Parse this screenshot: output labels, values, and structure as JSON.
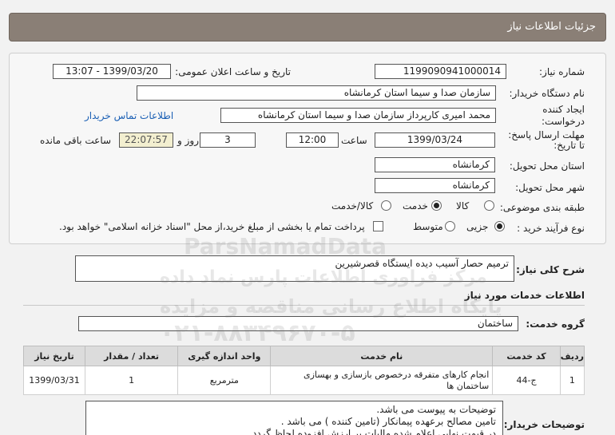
{
  "header": {
    "title": "جزئیات اطلاعات نیاز"
  },
  "fields": {
    "need_number_label": "شماره نیاز:",
    "need_number": "1199090941000014",
    "announce_label": "تاریخ و ساعت اعلان عمومی:",
    "announce_value": "1399/03/20 - 13:07",
    "buyer_label": "نام دستگاه خریدار:",
    "buyer_value": "سازمان صدا و سیما استان کرمانشاه",
    "creator_label_1": "ایجاد کننده",
    "creator_label_2": "درخواست:",
    "creator_value": "محمد امیری کارپرداز سازمان صدا و سیما استان کرمانشاه",
    "contact_link": "اطلاعات تماس خریدار",
    "deadline_label_1": "مهلت ارسال پاسخ:",
    "deadline_label_2": "تا تاریخ:",
    "deadline_date": "1399/03/24",
    "time_label": "ساعت",
    "deadline_time": "12:00",
    "days_value": "3",
    "days_label": "روز و",
    "remaining_time": "22:07:57",
    "remaining_label": "ساعت باقی مانده",
    "province_label": "استان محل تحویل:",
    "province_value": "کرمانشاه",
    "city_label": "شهر محل تحویل:",
    "city_value": "کرمانشاه",
    "category_label": "طبقه بندی موضوعی:",
    "category_options": [
      "کالا",
      "خدمت",
      "کالا/خدمت"
    ],
    "category_selected": "خدمت",
    "process_label": "نوع فرآیند خرید :",
    "process_options": [
      "جزیی",
      "متوسط"
    ],
    "process_selected": "جزیی",
    "payment_note": "پرداخت تمام یا بخشی از مبلغ خرید،از محل \"اسناد خزانه اسلامی\" خواهد بود."
  },
  "summary": {
    "label": "شرح کلی نیاز:",
    "value": "ترمیم حصار آسیب دیده ایستگاه قصرشیرین"
  },
  "services_section": {
    "title": "اطلاعات خدمات مورد نیاز"
  },
  "service_group": {
    "label": "گروه خدمت:",
    "value": "ساختمان"
  },
  "table": {
    "headers": [
      "ردیف",
      "کد خدمت",
      "نام خدمت",
      "واحد اندازه گیری",
      "تعداد / مقدار",
      "تاریخ نیاز"
    ],
    "rows": [
      [
        "1",
        "ج-44",
        "انجام کارهای متفرقه درخصوص بازسازی و بهسازی ساختمان ها",
        "مترمربع",
        "1",
        "1399/03/31"
      ]
    ]
  },
  "buyer_notes": {
    "label": "توضیحات خریدار:",
    "lines": [
      "توضیحات به پیوست می باشد.",
      "تامین مصالح برعهده پیمانکار (تامین کننده ) می باشد .",
      "در قیمت نهایی اعلام شده مالیات بر ارزش افزوده لحاظ گردد ."
    ]
  },
  "watermark": {
    "line1": "ParsNamadData",
    "line2": "مرکز فراوری اطلاعات پارس نماد داده",
    "line3": "پایگاه اطلاع رسانی مناقصه و مزایده",
    "line4": "۰۲۱-۸۸۳۴۹۶۷۰-۵"
  },
  "colors": {
    "header_bg": "#8a7f76",
    "link": "#1a5fb4",
    "timer_bg": "#f3efd0"
  }
}
